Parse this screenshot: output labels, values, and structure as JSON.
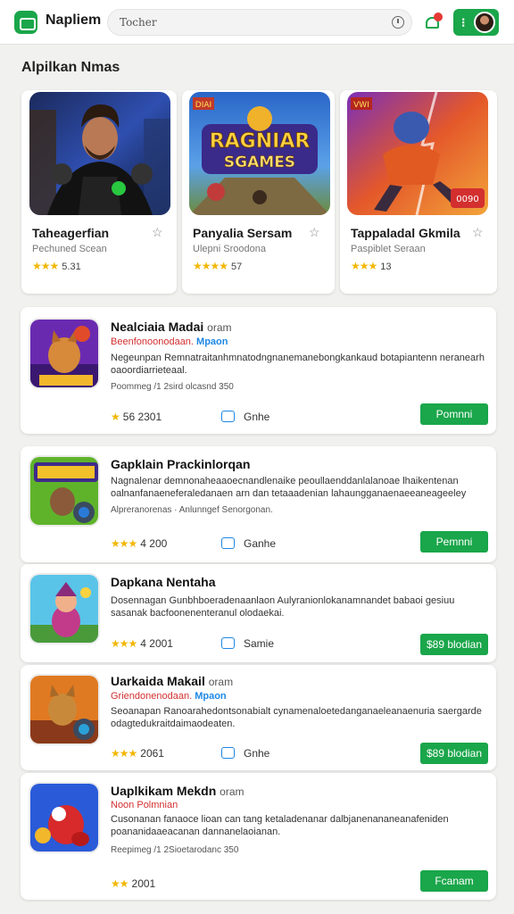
{
  "header": {
    "app_name": "Napliem",
    "search_value": "Tocher"
  },
  "section_title": "Alpilkan Nmas",
  "featured": [
    {
      "name": "Taheagerfian",
      "subtitle": "Pechuned Scean",
      "rating": "5.31",
      "stars": "★★★"
    },
    {
      "name": "Panyalia Sersam",
      "subtitle": "Ulepni Sroodona",
      "rating": "57",
      "stars": "★★★★"
    },
    {
      "name": "Tappaladal Gkmila",
      "subtitle": "Paspiblet Seraan",
      "rating": "13",
      "stars": "★★★"
    }
  ],
  "featured_art": [
    {
      "banner": ""
    },
    {
      "banner": "RAGNIAR SGAMES",
      "tag": "DIAI"
    },
    {
      "badge": "0090",
      "tag": "VWI"
    }
  ],
  "apps": [
    {
      "title": "Nealciaia Madai",
      "title_suffix": "oram",
      "sub_red": "Beenfonoonodaan.",
      "sub_blue": "Mpaon",
      "desc": "Negeunpan Remnatraitanhmnatodngnanemanebongkankaud botapiantenn neranearh oaoordiarrieteaal.",
      "meta": "Poommeg /1 2sird olcasnd 350",
      "rating": "56 2301",
      "stars": "★",
      "category": "Gnhe",
      "button": "Pomnni"
    },
    {
      "title": "Gapklain Prackinlorqan",
      "title_suffix": "",
      "sub_red": "",
      "sub_blue": "",
      "desc": "Nagnalenar demnonaheaaoecnandlenaike peoullaenddanlalanoae lhaikentenan oalnanfanaeneferaledanaen arn dan tetaaadenian lahaungganaenaeeaneageeley",
      "meta": "Alpreranorenas · Anlunngef Senorgonan.",
      "rating": "4 200",
      "stars": "★★★",
      "category": "Ganhe",
      "button": "Pemnni"
    },
    {
      "title": "Dapkana Nentaha",
      "title_suffix": "",
      "sub_red": "",
      "sub_blue": "",
      "desc": "Dosennagan Gunbhboeradenaanlaon Aulyranionlokanamnandet babaoi gesiuu sasanak bacfoonenenteranul olodaekai.",
      "meta": "",
      "rating": "4 2001",
      "stars": "★★★",
      "category": "Samie",
      "button": "$89 blodian"
    },
    {
      "title": "Uarkaida Makail",
      "title_suffix": "oram",
      "sub_red": "Griendonenodaan.",
      "sub_blue": "Mpaon",
      "desc": "Seoanapan Ranoarahedontsonabialt cynamenaloetedanganaeleanaenuria saergarde odagtedukraitdaimaodeaten.",
      "meta": "",
      "rating": "2061",
      "stars": "★★★",
      "category": "Gnhe",
      "button": "$89 blodian"
    },
    {
      "title": "Uaplkikam Mekdn",
      "title_suffix": "oram",
      "sub_red": "Noon Polmnian",
      "sub_blue": "",
      "desc": "Cusonanan fanaoce lioan can tang ketaladenanar dalbjanenananeanafeniden poananidaaeacanan dannanelaoianan.",
      "meta": "Reepimeg /1 2Sioetarodanc 350",
      "rating": "2001",
      "stars": "★★",
      "category": "",
      "button": "Fcanam"
    }
  ],
  "colors": {
    "brand_green": "#1aa64a",
    "accent_red": "#d32f2f",
    "accent_blue": "#1e88e5",
    "star_gold": "#f2b705"
  },
  "icons": [
    "app-logo-icon",
    "search-icon",
    "notification-icon",
    "menu-dots-icon",
    "chat-icon",
    "star-outline-icon"
  ]
}
